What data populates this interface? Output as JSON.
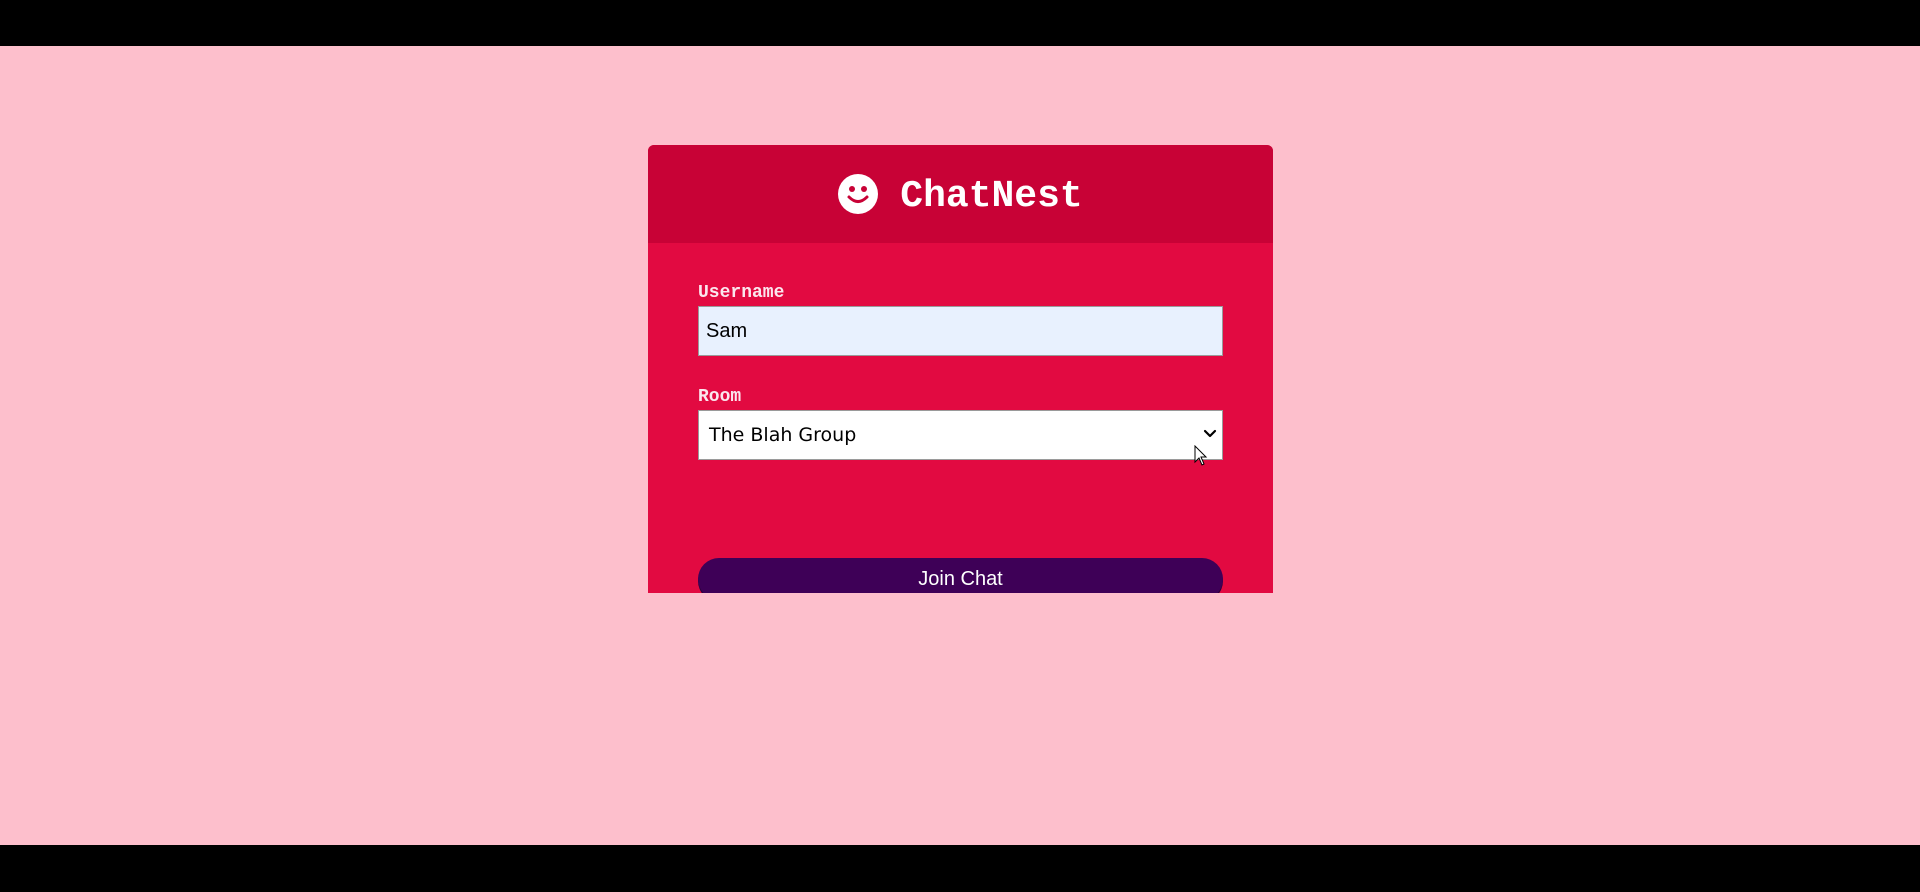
{
  "app": {
    "brand_name": "ChatNest",
    "logo_icon": "smiley-face-icon"
  },
  "form": {
    "username_label": "Username",
    "username_value": "Sam",
    "room_label": "Room",
    "room_selected": "The Blah Group",
    "join_label": "Join Chat"
  },
  "colors": {
    "page_background": "#fdbfcc",
    "header_background": "#c80236",
    "card_background": "#e20a41",
    "button_background": "#3e0057",
    "input_background": "#e8f1fe"
  }
}
